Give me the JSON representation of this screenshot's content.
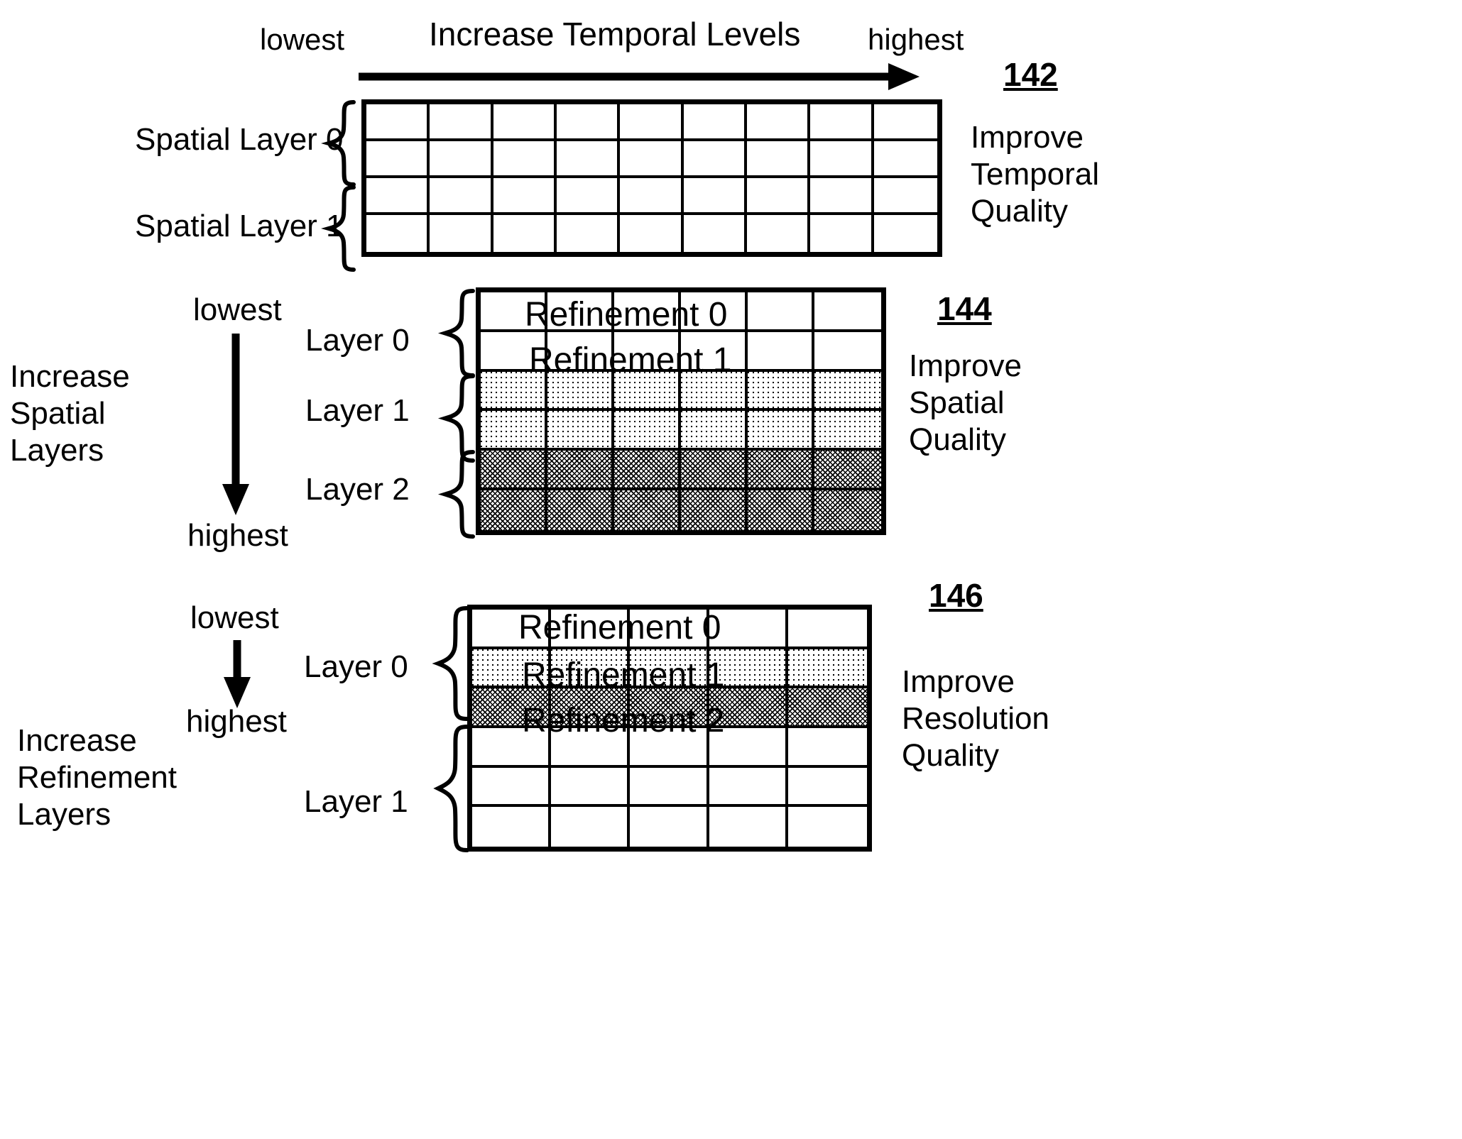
{
  "figures": {
    "fig142": "142",
    "fig144": "144",
    "fig146": "146"
  },
  "panel_temporal": {
    "axis_title": "Increase Temporal Levels",
    "axis_low": "lowest",
    "axis_high": "highest",
    "brace_labels": [
      "Spatial Layer 0",
      "Spatial Layer 1"
    ],
    "right_label": "Improve\nTemporal\nQuality",
    "right_label_lines": [
      "Improve",
      "Temporal",
      "Quality"
    ],
    "grid": {
      "columns": 9,
      "rows": 4
    }
  },
  "panel_spatial": {
    "axis_title_lines": [
      "Increase",
      "Spatial",
      "Layers"
    ],
    "axis_low": "lowest",
    "axis_high": "highest",
    "brace_labels": [
      "Layer 0",
      "Layer 1",
      "Layer 2"
    ],
    "right_label_lines": [
      "Improve",
      "Spatial",
      "Quality"
    ],
    "cell_labels": [
      "Refinement 0",
      "Refinement 1"
    ],
    "grid": {
      "columns": 6,
      "rows": 6,
      "row_shading": [
        "none",
        "none",
        "light",
        "light",
        "dark",
        "dark"
      ]
    }
  },
  "panel_resolution": {
    "axis_title_lines": [
      "Increase",
      "Refinement",
      "Layers"
    ],
    "axis_low": "lowest",
    "axis_high": "highest",
    "brace_labels": [
      "Layer 0",
      "Layer 1"
    ],
    "right_label_lines": [
      "Improve",
      "Resolution",
      "Quality"
    ],
    "cell_labels": [
      "Refinement 0",
      "Refinement 1",
      "Refinement 2"
    ],
    "grid": {
      "columns": 5,
      "rows": 6,
      "row_shading": [
        "none",
        "light",
        "dark",
        "none",
        "none",
        "none"
      ]
    }
  },
  "colors": {
    "ink": "#000000",
    "paper": "#ffffff"
  }
}
